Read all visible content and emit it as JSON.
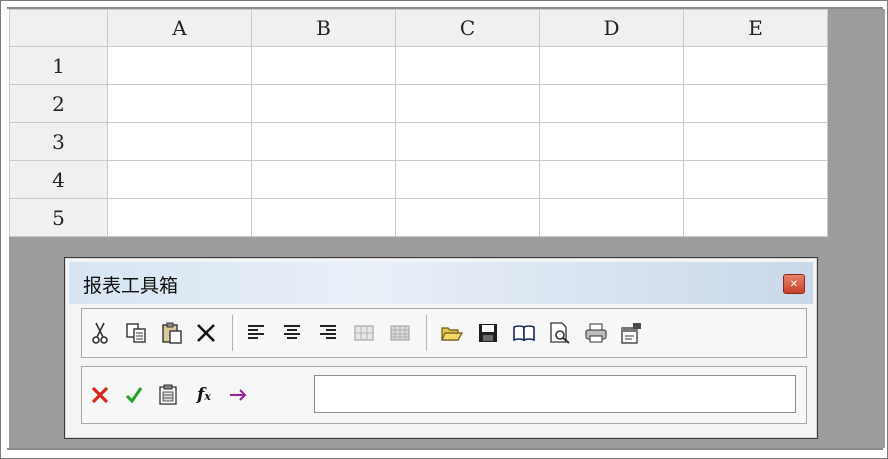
{
  "spreadsheet": {
    "columns": [
      "A",
      "B",
      "C",
      "D",
      "E"
    ],
    "rows": [
      "1",
      "2",
      "3",
      "4",
      "5"
    ]
  },
  "toolbox": {
    "title": "报表工具箱",
    "close_icon": "close-icon",
    "edit_tools": [
      "cut-icon",
      "copy-icon",
      "paste-icon",
      "delete-icon"
    ],
    "align_tools": [
      "align-left-icon",
      "align-center-icon",
      "align-right-icon",
      "merge-cells-icon",
      "split-cells-icon"
    ],
    "file_tools": [
      "open-folder-icon",
      "save-icon",
      "book-icon",
      "print-preview-icon",
      "print-icon",
      "properties-icon"
    ],
    "formula_tools": [
      "cancel-icon",
      "confirm-icon",
      "function-list-icon",
      "fx-icon",
      "arrow-right-icon"
    ],
    "formula_value": "",
    "colors": {
      "cancel": "#d42a1a",
      "confirm": "#23a323",
      "arrow": "#9a1f9a",
      "close": "#c8402a"
    }
  }
}
